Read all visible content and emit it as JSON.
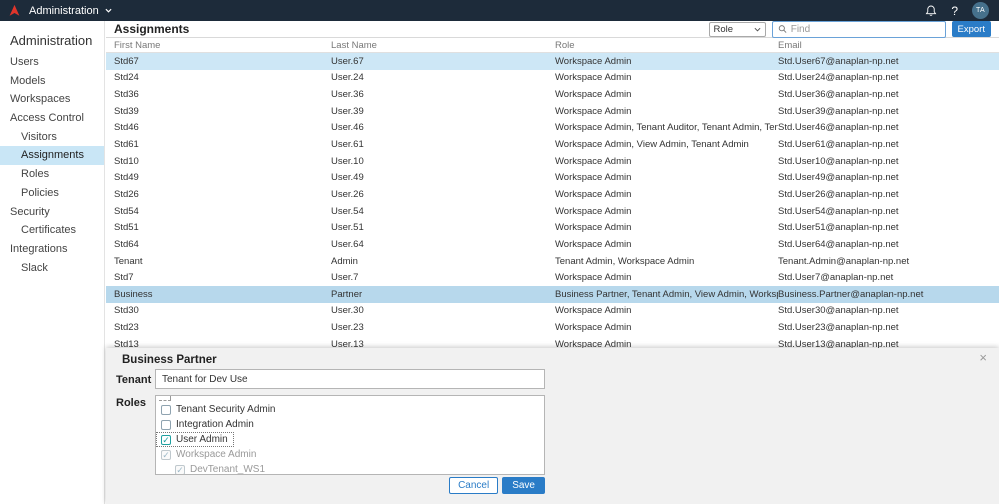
{
  "colors": {
    "topbar": "#1d2b3a",
    "brand_red": "#e0352b",
    "accent": "#2a7cc7",
    "sidebar_selected": "#c9e6f6",
    "row_highlight": "#cde7f6",
    "row_selected": "#b7d8ec"
  },
  "topbar": {
    "app_menu": "Administration",
    "avatar": "TA",
    "icons": [
      "anaplan-logo-icon",
      "chevron-down-icon",
      "bell-icon",
      "help-icon"
    ]
  },
  "sidebar": {
    "title": "Administration",
    "items": [
      {
        "label": "Users",
        "indent": 0,
        "selected": false
      },
      {
        "label": "Models",
        "indent": 0,
        "selected": false
      },
      {
        "label": "Workspaces",
        "indent": 0,
        "selected": false
      },
      {
        "label": "Access Control",
        "indent": 0,
        "selected": false
      },
      {
        "label": "Visitors",
        "indent": 1,
        "selected": false
      },
      {
        "label": "Assignments",
        "indent": 1,
        "selected": true
      },
      {
        "label": "Roles",
        "indent": 1,
        "selected": false
      },
      {
        "label": "Policies",
        "indent": 1,
        "selected": false
      },
      {
        "label": "Security",
        "indent": 0,
        "selected": false
      },
      {
        "label": "Certificates",
        "indent": 1,
        "selected": false
      },
      {
        "label": "Integrations",
        "indent": 0,
        "selected": false
      },
      {
        "label": "Slack",
        "indent": 1,
        "selected": false
      }
    ]
  },
  "main": {
    "title": "Assignments",
    "role_filter_label": "Role",
    "find_placeholder": "Find",
    "export_label": "Export",
    "table": {
      "columns": [
        "First Name",
        "Last Name",
        "Role",
        "Email"
      ],
      "rows": [
        {
          "first": "Std67",
          "last": "User.67",
          "role": "Workspace Admin",
          "email": "Std.User67@anaplan-np.net",
          "state": "highlighted"
        },
        {
          "first": "Std24",
          "last": "User.24",
          "role": "Workspace Admin",
          "email": "Std.User24@anaplan-np.net",
          "state": ""
        },
        {
          "first": "Std36",
          "last": "User.36",
          "role": "Workspace Admin",
          "email": "Std.User36@anaplan-np.net",
          "state": ""
        },
        {
          "first": "Std39",
          "last": "User.39",
          "role": "Workspace Admin",
          "email": "Std.User39@anaplan-np.net",
          "state": ""
        },
        {
          "first": "Std46",
          "last": "User.46",
          "role": "Workspace Admin, Tenant Auditor, Tenant Admin, Tenant Security Admin",
          "email": "Std.User46@anaplan-np.net",
          "state": ""
        },
        {
          "first": "Std61",
          "last": "User.61",
          "role": "Workspace Admin, View Admin, Tenant Admin",
          "email": "Std.User61@anaplan-np.net",
          "state": ""
        },
        {
          "first": "Std10",
          "last": "User.10",
          "role": "Workspace Admin",
          "email": "Std.User10@anaplan-np.net",
          "state": ""
        },
        {
          "first": "Std49",
          "last": "User.49",
          "role": "Workspace Admin",
          "email": "Std.User49@anaplan-np.net",
          "state": ""
        },
        {
          "first": "Std26",
          "last": "User.26",
          "role": "Workspace Admin",
          "email": "Std.User26@anaplan-np.net",
          "state": ""
        },
        {
          "first": "Std54",
          "last": "User.54",
          "role": "Workspace Admin",
          "email": "Std.User54@anaplan-np.net",
          "state": ""
        },
        {
          "first": "Std51",
          "last": "User.51",
          "role": "Workspace Admin",
          "email": "Std.User51@anaplan-np.net",
          "state": ""
        },
        {
          "first": "Std64",
          "last": "User.64",
          "role": "Workspace Admin",
          "email": "Std.User64@anaplan-np.net",
          "state": ""
        },
        {
          "first": "Tenant",
          "last": "Admin",
          "role": "Tenant Admin, Workspace Admin",
          "email": "Tenant.Admin@anaplan-np.net",
          "state": ""
        },
        {
          "first": "Std7",
          "last": "User.7",
          "role": "Workspace Admin",
          "email": "Std.User7@anaplan-np.net",
          "state": ""
        },
        {
          "first": "Business",
          "last": "Partner",
          "role": "Business Partner, Tenant Admin, View Admin, Workspace Admin",
          "email": "Business.Partner@anaplan-np.net",
          "state": "selected"
        },
        {
          "first": "Std30",
          "last": "User.30",
          "role": "Workspace Admin",
          "email": "Std.User30@anaplan-np.net",
          "state": ""
        },
        {
          "first": "Std23",
          "last": "User.23",
          "role": "Workspace Admin",
          "email": "Std.User23@anaplan-np.net",
          "state": ""
        },
        {
          "first": "Std13",
          "last": "User.13",
          "role": "Workspace Admin",
          "email": "Std.User13@anaplan-np.net",
          "state": ""
        }
      ]
    }
  },
  "panel": {
    "title": "Business Partner",
    "close_glyph": "×",
    "tenant_label": "Tenant",
    "tenant_value": "Tenant for Dev Use",
    "roles_label": "Roles",
    "role_options": [
      {
        "label": "Tenant Security Admin",
        "checked": false,
        "disabled": false,
        "focused": false,
        "indent": 0
      },
      {
        "label": "Integration Admin",
        "checked": false,
        "disabled": false,
        "focused": false,
        "indent": 0
      },
      {
        "label": "User Admin",
        "checked": true,
        "disabled": false,
        "focused": true,
        "indent": 0
      },
      {
        "label": "Workspace Admin",
        "checked": true,
        "disabled": true,
        "focused": false,
        "indent": 0
      },
      {
        "label": "DevTenant_WS1",
        "checked": true,
        "disabled": true,
        "focused": false,
        "indent": 1
      }
    ],
    "cancel_label": "Cancel",
    "save_label": "Save"
  }
}
